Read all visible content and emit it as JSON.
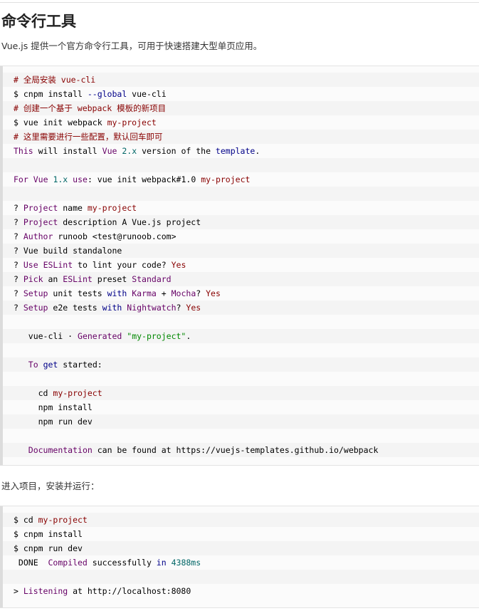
{
  "heading": "命令行工具",
  "intro": "Vue.js 提供一个官方命令行工具，可用于快速搭建大型单页应用。",
  "code_block_1": [
    [
      [
        "# 全局安装 vue-cli",
        "c"
      ]
    ],
    [
      [
        "$ cnpm install ",
        ""
      ],
      [
        "--global",
        "k"
      ],
      [
        " vue-cli",
        ""
      ]
    ],
    [
      [
        "# 创建一个基于 webpack 模板的新项目",
        "c"
      ]
    ],
    [
      [
        "$ vue init webpack ",
        ""
      ],
      [
        "my-project",
        "c"
      ]
    ],
    [
      [
        "# 这里需要进行一些配置，默认回车即可",
        "c"
      ]
    ],
    [
      [
        "This",
        "t"
      ],
      [
        " will install ",
        ""
      ],
      [
        "Vue",
        "t"
      ],
      [
        " ",
        ""
      ],
      [
        "2.x",
        "n"
      ],
      [
        " version of the ",
        ""
      ],
      [
        "template",
        "k"
      ],
      [
        ".",
        ""
      ]
    ],
    [],
    [
      [
        "For",
        "t"
      ],
      [
        " ",
        ""
      ],
      [
        "Vue",
        "t"
      ],
      [
        " ",
        ""
      ],
      [
        "1.x",
        "n"
      ],
      [
        " ",
        ""
      ],
      [
        "use",
        "t"
      ],
      [
        ": vue init webpack#1.0 ",
        ""
      ],
      [
        "my-project",
        "c"
      ]
    ],
    [],
    [
      [
        "? ",
        ""
      ],
      [
        "Project",
        "t"
      ],
      [
        " name ",
        ""
      ],
      [
        "my-project",
        "c"
      ]
    ],
    [
      [
        "? ",
        ""
      ],
      [
        "Project",
        "t"
      ],
      [
        " description A Vue.js project",
        ""
      ]
    ],
    [
      [
        "? ",
        ""
      ],
      [
        "Author",
        "t"
      ],
      [
        " runoob <test@runoob.com>",
        ""
      ]
    ],
    [
      [
        "? Vue build standalone",
        ""
      ]
    ],
    [
      [
        "? ",
        ""
      ],
      [
        "Use",
        "t"
      ],
      [
        " ",
        ""
      ],
      [
        "ESLint",
        "t"
      ],
      [
        " to lint your code? ",
        ""
      ],
      [
        "Yes",
        "c"
      ]
    ],
    [
      [
        "? ",
        ""
      ],
      [
        "Pick",
        "t"
      ],
      [
        " an ",
        ""
      ],
      [
        "ESLint",
        "t"
      ],
      [
        " preset ",
        ""
      ],
      [
        "Standard",
        "t"
      ]
    ],
    [
      [
        "? ",
        ""
      ],
      [
        "Setup",
        "t"
      ],
      [
        " unit tests ",
        ""
      ],
      [
        "with",
        "k"
      ],
      [
        " ",
        ""
      ],
      [
        "Karma",
        "t"
      ],
      [
        " + ",
        ""
      ],
      [
        "Mocha",
        "t"
      ],
      [
        "? ",
        ""
      ],
      [
        "Yes",
        "c"
      ]
    ],
    [
      [
        "? ",
        ""
      ],
      [
        "Setup",
        "t"
      ],
      [
        " e2e tests ",
        ""
      ],
      [
        "with",
        "k"
      ],
      [
        " ",
        ""
      ],
      [
        "Nightwatch",
        "t"
      ],
      [
        "? ",
        ""
      ],
      [
        "Yes",
        "c"
      ]
    ],
    [],
    [
      [
        "   vue-cli · ",
        ""
      ],
      [
        "Generated",
        "t"
      ],
      [
        " ",
        ""
      ],
      [
        "\"my-project\"",
        "s"
      ],
      [
        ".",
        ""
      ]
    ],
    [],
    [
      [
        "   ",
        ""
      ],
      [
        "To",
        "t"
      ],
      [
        " ",
        ""
      ],
      [
        "get",
        "k"
      ],
      [
        " started:",
        ""
      ]
    ],
    [],
    [
      [
        "     cd ",
        ""
      ],
      [
        "my-project",
        "c"
      ]
    ],
    [
      [
        "     npm install",
        ""
      ]
    ],
    [
      [
        "     npm run dev",
        ""
      ]
    ],
    [],
    [
      [
        "   ",
        ""
      ],
      [
        "Documentation",
        "t"
      ],
      [
        " can be found at https://vuejs-templates.github.io/webpack",
        ""
      ]
    ]
  ],
  "run_intro": "进入项目，安装并运行：",
  "code_block_2": [
    [
      [
        "$ cd ",
        ""
      ],
      [
        "my-project",
        "c"
      ]
    ],
    [
      [
        "$ cnpm install",
        ""
      ]
    ],
    [
      [
        "$ cnpm run dev",
        ""
      ]
    ],
    [
      [
        " DONE  ",
        ""
      ],
      [
        "Compiled",
        "t"
      ],
      [
        " successfully ",
        ""
      ],
      [
        "in",
        "k"
      ],
      [
        " ",
        ""
      ],
      [
        "4388ms",
        "n"
      ]
    ],
    [],
    [
      [
        "> ",
        ""
      ],
      [
        "Listening",
        "t"
      ],
      [
        " at http://localhost:8080",
        ""
      ]
    ]
  ]
}
